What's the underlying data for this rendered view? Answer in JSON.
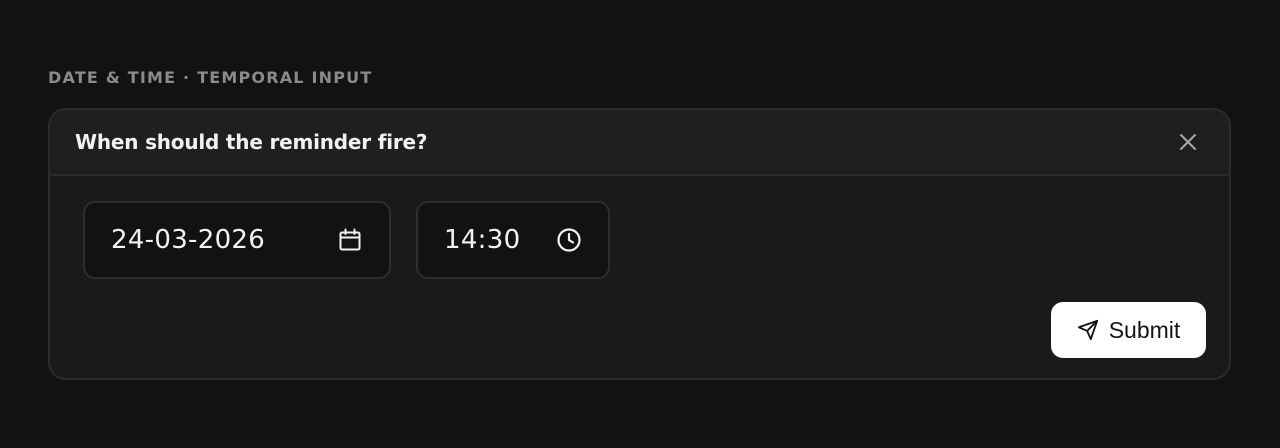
{
  "section": {
    "label": "DATE & TIME · TEMPORAL INPUT"
  },
  "card": {
    "title": "When should the reminder fire?",
    "close_icon": "close-icon"
  },
  "date_field": {
    "value": "24-03-2026",
    "icon": "calendar-icon"
  },
  "time_field": {
    "value": "14:30",
    "icon": "clock-icon"
  },
  "submit": {
    "label": "Submit",
    "icon": "send-icon"
  },
  "colors": {
    "background": "#121212",
    "card": "#1a1a1a",
    "header": "#1f1f1f",
    "border": "#2c2c2c",
    "input_bg": "#121212",
    "button_bg": "#ffffff"
  }
}
